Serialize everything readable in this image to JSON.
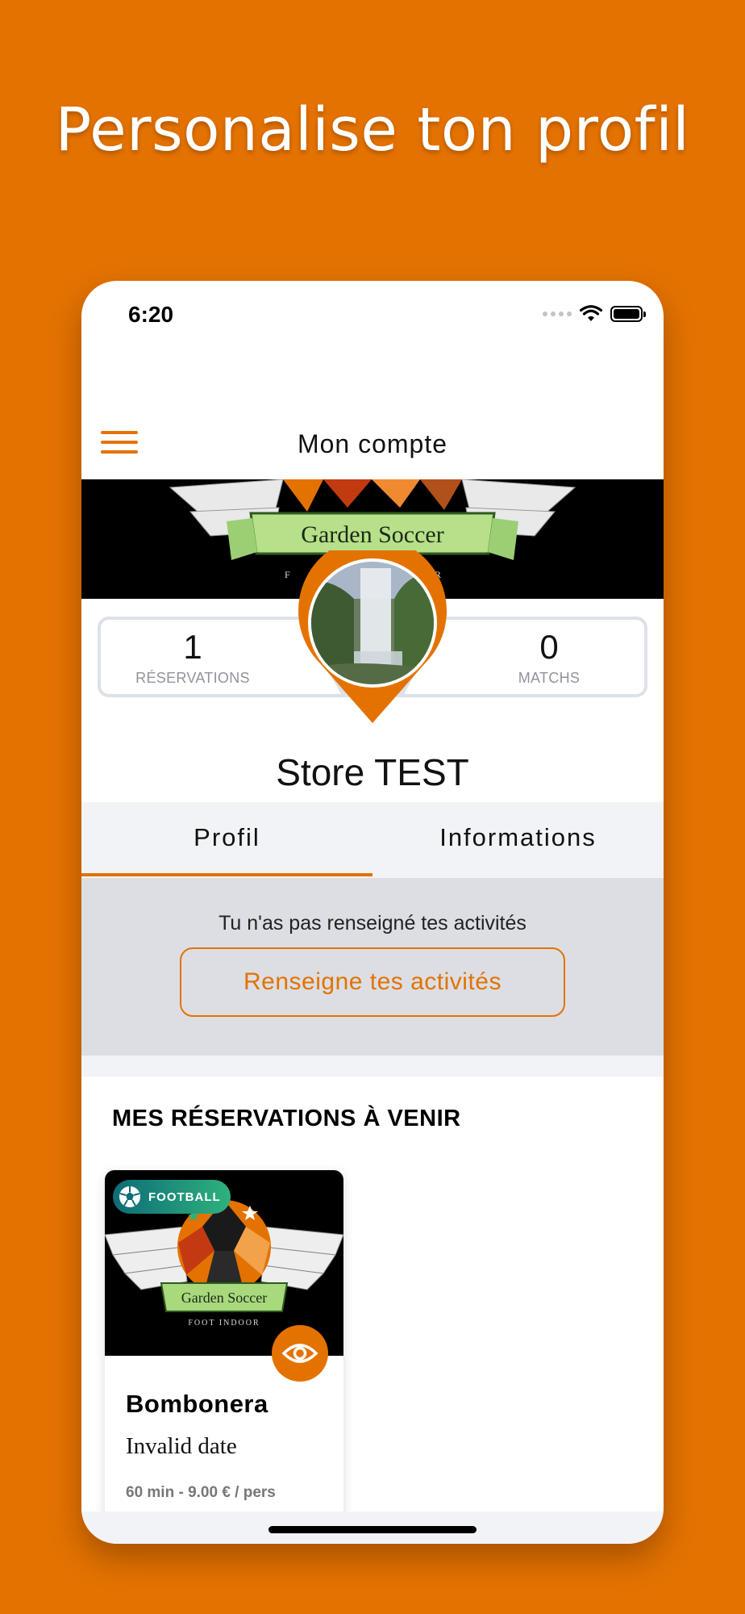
{
  "headline": "Personalise ton profil",
  "status_bar": {
    "time": "6:20",
    "icons": [
      "signal-dots-icon",
      "wifi-icon",
      "battery-icon"
    ]
  },
  "navbar": {
    "title": "Mon compte",
    "menu_icon": "hamburger-menu-icon"
  },
  "banner": {
    "logo_text": "Garden Soccer"
  },
  "stats": {
    "reservations": {
      "value": "1",
      "label": "RÉSERVATIONS"
    },
    "matches": {
      "value": "0",
      "label": "MATCHS"
    }
  },
  "profile": {
    "name": "Store TEST"
  },
  "tabs": [
    {
      "label": "Profil",
      "active": true
    },
    {
      "label": "Informations",
      "active": false
    }
  ],
  "activities": {
    "message": "Tu n'as pas renseigné tes activités",
    "button_label": "Renseigne tes activités"
  },
  "upcoming": {
    "section_title": "MES RÉSERVATIONS À VENIR",
    "bookings": [
      {
        "sport": "FOOTBALL",
        "logo_text": "Garden Soccer",
        "logo_subtext": "FOOT INDOOR",
        "venue": "Bombonera",
        "date": "Invalid date",
        "meta": "60 min - 9.00 € / pers"
      }
    ]
  },
  "colors": {
    "accent": "#E47200",
    "panel_grey": "#DCDEE3",
    "badge_gradient": [
      "#0E6C78",
      "#2EB27C"
    ]
  }
}
